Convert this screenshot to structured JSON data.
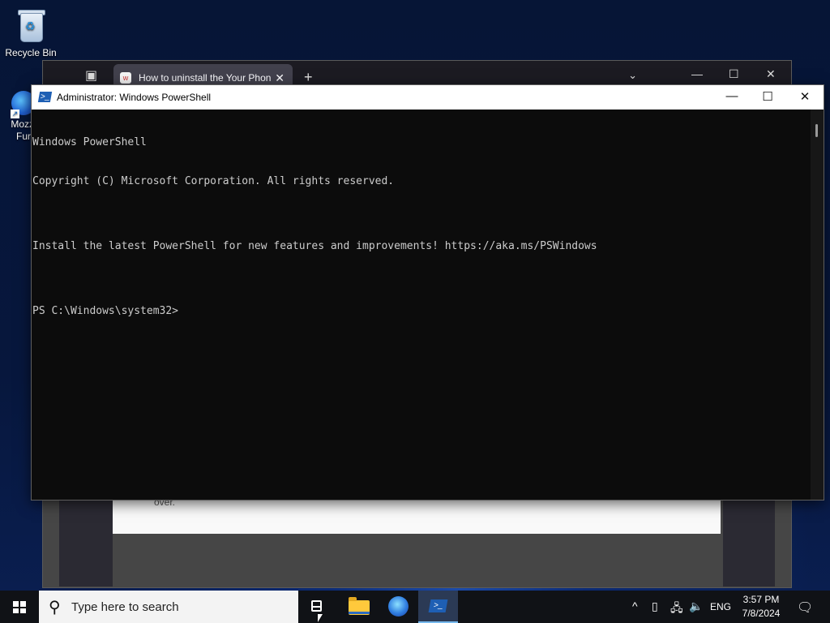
{
  "desktop": {
    "recycle_bin_label": "Recycle Bin",
    "firefox_label_line1": "Mozz",
    "firefox_label_line2": "Furr"
  },
  "browser": {
    "tab_title": "How to uninstall the Your Phon",
    "tab_close": "✕",
    "new_tab": "+",
    "tabs_list": "⌄",
    "minimize": "—",
    "maximize": "☐",
    "close": "✕",
    "page_text": "over."
  },
  "powershell": {
    "title": "Administrator: Windows PowerShell",
    "icon_glyph": ">_",
    "minimize": "—",
    "maximize": "☐",
    "close": "✕",
    "console_lines": [
      "Windows PowerShell",
      "Copyright (C) Microsoft Corporation. All rights reserved.",
      "",
      "Install the latest PowerShell for new features and improvements! https://aka.ms/PSWindows",
      "",
      "PS C:\\Windows\\system32>"
    ]
  },
  "taskbar": {
    "search_placeholder": "Type here to search",
    "powershell_glyph": ">_",
    "tray": {
      "chevron": "^",
      "language": "ENG",
      "time": "3:57 PM",
      "date": "7/8/2024"
    }
  },
  "colors": {
    "console_bg": "#0c0c0c",
    "console_fg": "#cccccc",
    "taskbar_bg": "#101216",
    "active_indicator": "#76b9ed"
  }
}
